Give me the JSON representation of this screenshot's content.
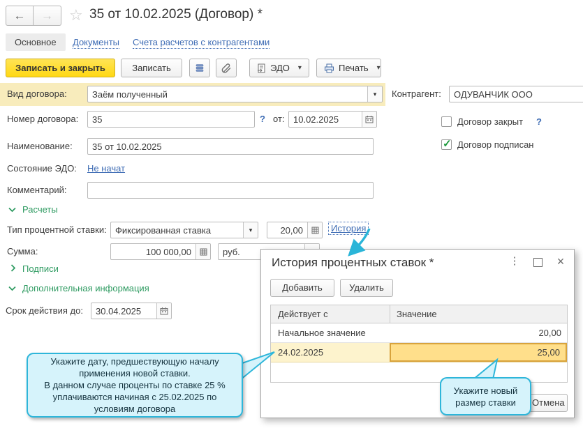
{
  "icons": {
    "back": "←",
    "forward": "→",
    "star": "☆",
    "caret": "▾",
    "kebab": "⋮",
    "close": "×",
    "check": "✓",
    "help": "?"
  },
  "header": {
    "title": "35 от 10.02.2025 (Договор) *"
  },
  "tabs": [
    {
      "label": "Основное"
    },
    {
      "label": "Документы"
    },
    {
      "label": "Счета расчетов с контрагентами"
    }
  ],
  "toolbar": {
    "save_close": "Записать и закрыть",
    "save": "Записать",
    "edo": "ЭДО",
    "print": "Печать"
  },
  "form": {
    "contract_type_label": "Вид договора:",
    "contract_type_value": "Заём полученный",
    "counterparty_label": "Контрагент:",
    "counterparty_value": "ОДУВАНЧИК ООО",
    "number_label": "Номер договора:",
    "number_value": "35",
    "date_label": "от:",
    "date_value": "10.02.2025",
    "closed_label": "Договор закрыт",
    "signed_label": "Договор подписан",
    "name_label": "Наименование:",
    "name_value": "35 от 10.02.2025",
    "edo_label": "Состояние ЭДО:",
    "edo_value": "Не начат",
    "comment_label": "Комментарий:",
    "comment_value": "",
    "section_calc": "Расчеты",
    "rate_type_label": "Тип процентной ставки:",
    "rate_type_value": "Фиксированная ставка",
    "rate_value": "20,00",
    "history_link": "История",
    "amount_label": "Сумма:",
    "amount_value": "100 000,00",
    "currency": "руб.",
    "section_sign": "Подписи",
    "section_extra": "Дополнительная информация",
    "valid_label": "Срок действия до:",
    "valid_value": "30.04.2025"
  },
  "popup": {
    "title": "История процентных ставок *",
    "add": "Добавить",
    "del": "Удалить",
    "cancel": "Отмена",
    "col1": "Действует с",
    "col2": "Значение",
    "rows": [
      {
        "date": "Начальное значение",
        "value": "20,00"
      },
      {
        "date": "24.02.2025",
        "value": "25,00"
      }
    ]
  },
  "callouts": {
    "left": "Укажите дату, предшествующую началу применения новой ставки.\nВ данном случае проценты по ставке 25 % уплачиваются начиная с 25.02.2025 по условиям договора",
    "right": "Укажите новый размер ставки"
  },
  "colors": {
    "accent_yellow": "#ffde35",
    "highlight_row": "#f8ecbc",
    "selected_row": "#fdf3cd",
    "selected_cell": "#ffdf8b",
    "selected_cell_border": "#d8a33c",
    "callout_bg": "#d6f3fb",
    "callout_border": "#2eb6da",
    "link": "#3e6cb4",
    "section_green": "#2d9a60"
  }
}
